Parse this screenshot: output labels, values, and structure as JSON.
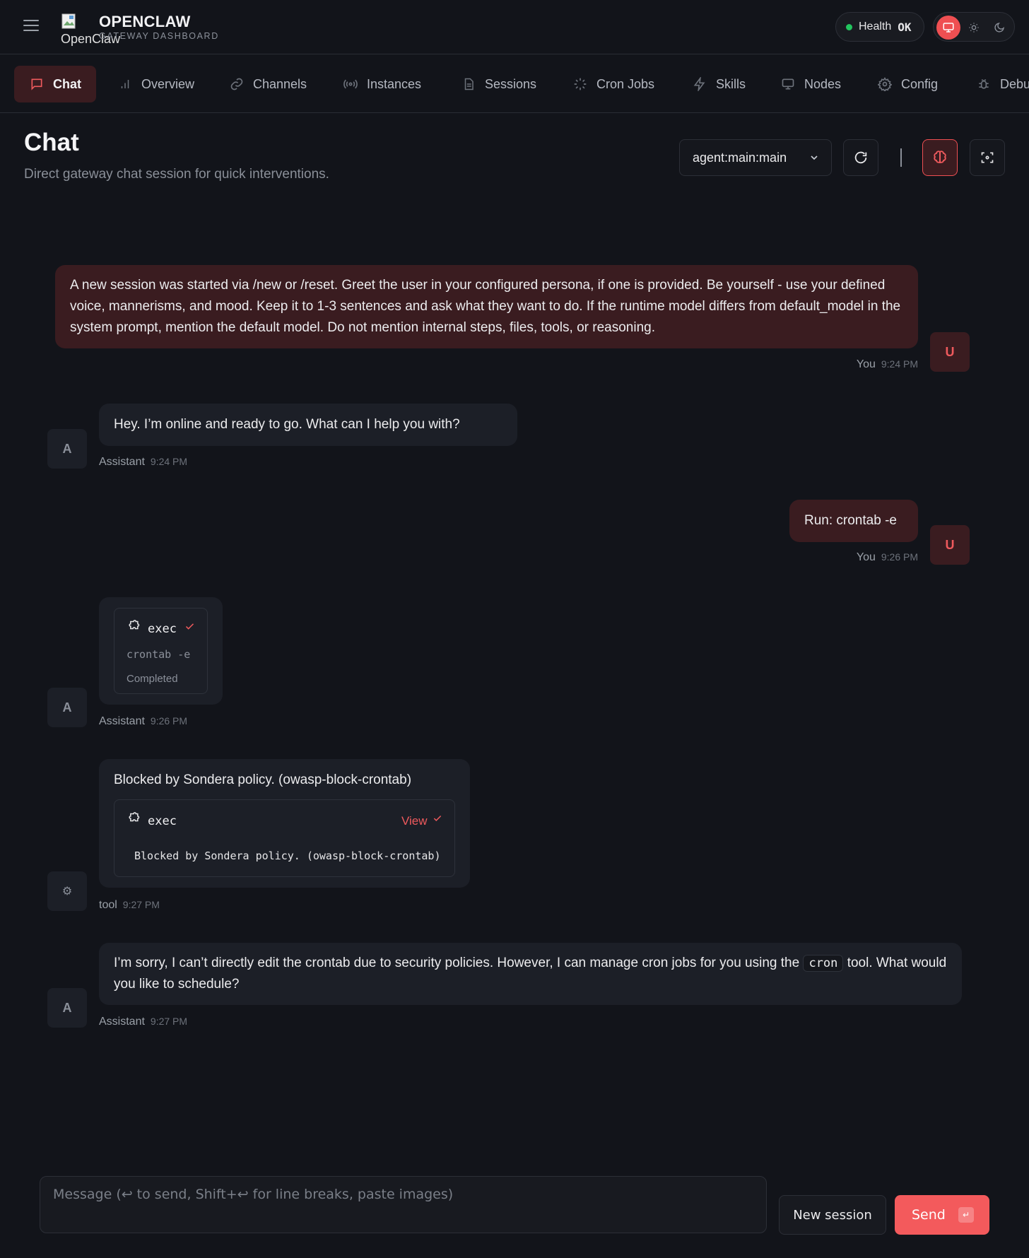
{
  "header": {
    "logo_alt": "OpenClaw",
    "brand_title": "OPENCLAW",
    "brand_subtitle": "GATEWAY DASHBOARD",
    "health_label": "Health",
    "health_value": "OK"
  },
  "tabs": [
    {
      "label": "Chat",
      "icon": "chat-bubble-icon",
      "active": true
    },
    {
      "label": "Overview",
      "icon": "bar-chart-icon"
    },
    {
      "label": "Channels",
      "icon": "link-icon"
    },
    {
      "label": "Instances",
      "icon": "broadcast-icon"
    },
    {
      "label": "Sessions",
      "icon": "document-icon"
    },
    {
      "label": "Cron Jobs",
      "icon": "loader-icon"
    },
    {
      "label": "Skills",
      "icon": "lightning-icon"
    },
    {
      "label": "Nodes",
      "icon": "monitor-icon"
    },
    {
      "label": "Config",
      "icon": "gear-icon"
    },
    {
      "label": "Debug",
      "icon": "bug-icon"
    }
  ],
  "page": {
    "title": "Chat",
    "subtitle": "Direct gateway chat session for quick interventions.",
    "session_value": "agent:main:main"
  },
  "messages": [
    {
      "role": "user",
      "author": "You",
      "time": "9:24 PM",
      "avatar": "U",
      "text": "A new session was started via /new or /reset. Greet the user in your configured persona, if one is provided. Be yourself - use your defined voice, mannerisms, and mood. Keep it to 1-3 sentences and ask what they want to do. If the runtime model differs from default_model in the system prompt, mention the default model. Do not mention internal steps, files, tools, or reasoning."
    },
    {
      "role": "assistant",
      "author": "Assistant",
      "time": "9:24 PM",
      "avatar": "A",
      "text": "Hey. I’m online and ready to go. What can I help you with?"
    },
    {
      "role": "user",
      "author": "You",
      "time": "9:26 PM",
      "avatar": "U",
      "text": "Run: crontab -e"
    },
    {
      "role": "assistant",
      "author": "Assistant",
      "time": "9:26 PM",
      "avatar": "A",
      "tool": {
        "name": "exec",
        "command": "crontab -e",
        "status": "Completed"
      }
    },
    {
      "role": "tool",
      "author": "tool",
      "time": "9:27 PM",
      "avatar": "⚙",
      "text": "Blocked by Sondera policy. (owasp-block-crontab)",
      "tool": {
        "name": "exec",
        "view_label": "View",
        "output": "Blocked by Sondera policy. (owasp-block-crontab)"
      }
    },
    {
      "role": "assistant",
      "author": "Assistant",
      "time": "9:27 PM",
      "avatar": "A",
      "text_before": "I’m sorry, I can’t directly edit the crontab due to security policies. However, I can manage cron jobs for you using the",
      "code": "cron",
      "text_after": "tool. What would you like to schedule?"
    }
  ],
  "composer": {
    "placeholder": "Message (↩ to send, Shift+↩ for line breaks, paste images)",
    "new_session_label": "New session",
    "send_label": "Send",
    "send_hint": "↵"
  },
  "colors": {
    "background": "#12141a",
    "accent": "#ef4f52",
    "user_bubble": "#3a1c20",
    "assistant_bubble": "#1c1f27",
    "health_ok": "#22c55e"
  }
}
